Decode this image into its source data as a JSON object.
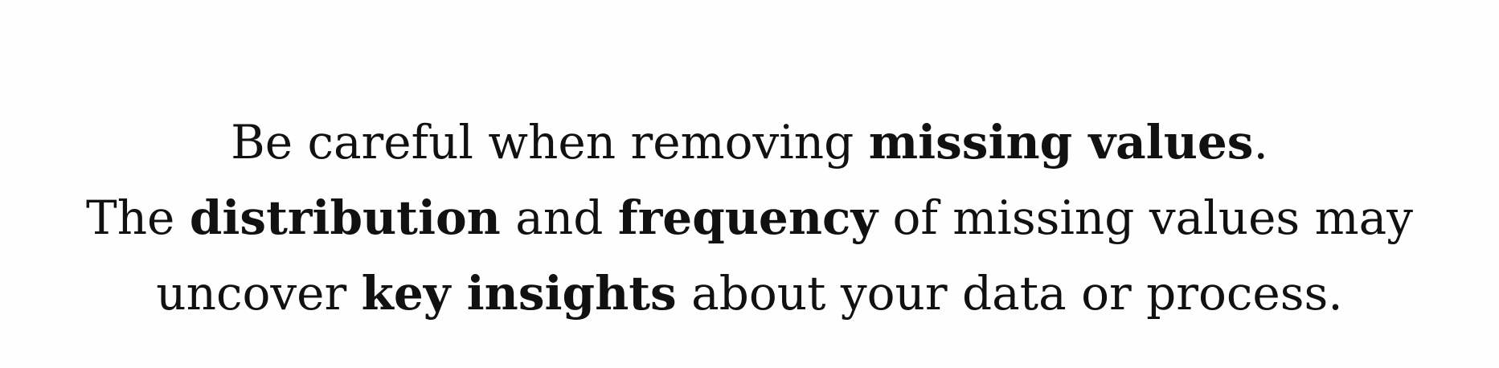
{
  "lines": [
    [
      {
        "text": "Be careful when removing ",
        "bold": false
      },
      {
        "text": "missing values",
        "bold": true
      },
      {
        "text": ".",
        "bold": false
      }
    ],
    [
      {
        "text": "The ",
        "bold": false
      },
      {
        "text": "distribution",
        "bold": true
      },
      {
        "text": " and ",
        "bold": false
      },
      {
        "text": "frequency",
        "bold": true
      },
      {
        "text": " of missing values may",
        "bold": false
      }
    ],
    [
      {
        "text": "uncover ",
        "bold": false
      },
      {
        "text": "key insights",
        "bold": true
      },
      {
        "text": " about your data or process.",
        "bold": false
      }
    ]
  ]
}
